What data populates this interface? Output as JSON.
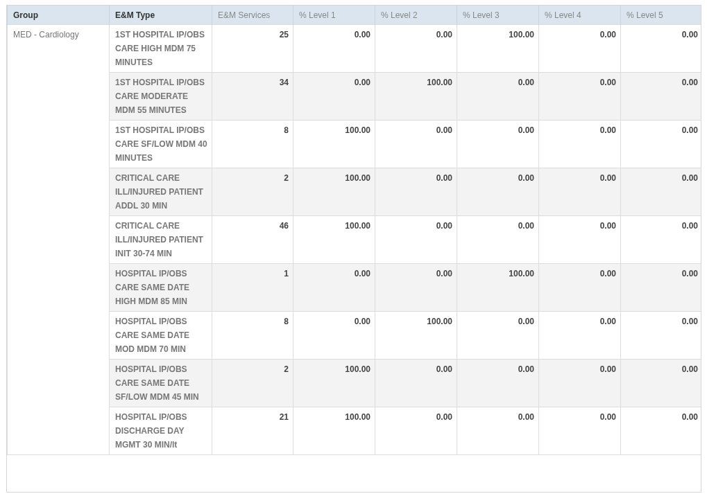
{
  "table": {
    "columns": [
      {
        "label": "Group",
        "kind": "dimension"
      },
      {
        "label": "E&M Type",
        "kind": "dimension"
      },
      {
        "label": "E&M Services",
        "kind": "measure"
      },
      {
        "label": "% Level 1",
        "kind": "measure"
      },
      {
        "label": "% Level 2",
        "kind": "measure"
      },
      {
        "label": "% Level 3",
        "kind": "measure"
      },
      {
        "label": "% Level 4",
        "kind": "measure"
      },
      {
        "label": "% Level 5",
        "kind": "measure"
      }
    ],
    "groups": [
      {
        "name": "MED - Cardiology",
        "rows": [
          {
            "type": "1ST HOSPITAL IP/OBS CARE HIGH MDM 75 MINUTES",
            "values": [
              "25",
              "0.00",
              "0.00",
              "100.00",
              "0.00",
              "0.00"
            ]
          },
          {
            "type": "1ST HOSPITAL IP/OBS CARE MODERATE MDM 55 MINUTES",
            "values": [
              "34",
              "0.00",
              "100.00",
              "0.00",
              "0.00",
              "0.00"
            ]
          },
          {
            "type": "1ST HOSPITAL IP/OBS CARE SF/LOW MDM 40 MINUTES",
            "values": [
              "8",
              "100.00",
              "0.00",
              "0.00",
              "0.00",
              "0.00"
            ]
          },
          {
            "type": "CRITICAL CARE ILL/INJURED PATIENT ADDL 30 MIN",
            "values": [
              "2",
              "100.00",
              "0.00",
              "0.00",
              "0.00",
              "0.00"
            ]
          },
          {
            "type": "CRITICAL CARE ILL/INJURED PATIENT INIT 30-74 MIN",
            "values": [
              "46",
              "100.00",
              "0.00",
              "0.00",
              "0.00",
              "0.00"
            ]
          },
          {
            "type": "HOSPITAL IP/OBS CARE SAME DATE HIGH MDM 85 MIN",
            "values": [
              "1",
              "0.00",
              "0.00",
              "100.00",
              "0.00",
              "0.00"
            ]
          },
          {
            "type": "HOSPITAL IP/OBS CARE SAME DATE MOD MDM 70 MIN",
            "values": [
              "8",
              "0.00",
              "100.00",
              "0.00",
              "0.00",
              "0.00"
            ]
          },
          {
            "type": "HOSPITAL IP/OBS CARE SAME DATE SF/LOW MDM 45 MIN",
            "values": [
              "2",
              "100.00",
              "0.00",
              "0.00",
              "0.00",
              "0.00"
            ]
          },
          {
            "type": "HOSPITAL IP/OBS DISCHARGE DAY MGMT 30 MIN/lt",
            "values": [
              "21",
              "100.00",
              "0.00",
              "0.00",
              "0.00",
              "0.00"
            ]
          }
        ]
      }
    ]
  }
}
